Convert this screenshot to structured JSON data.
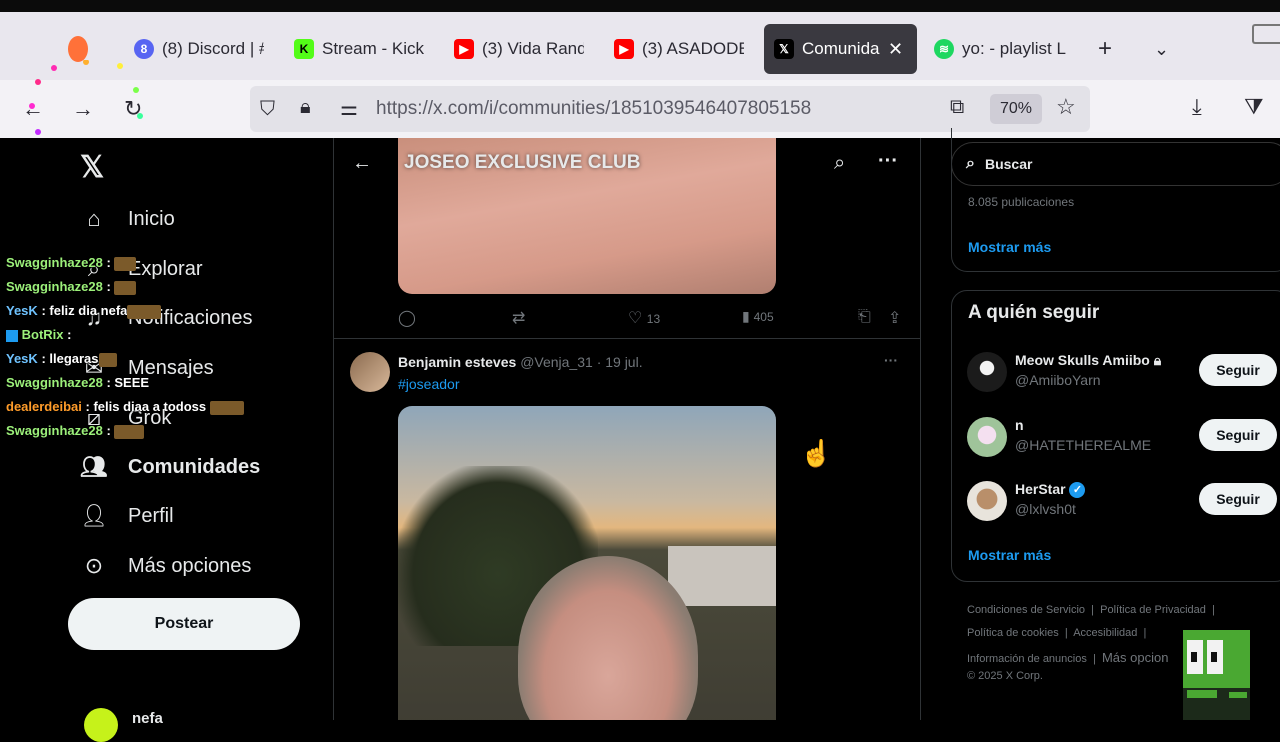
{
  "browser": {
    "tabs": [
      {
        "label": "(8) Discord | #",
        "icon": "discord-icon",
        "color": "#5865f2"
      },
      {
        "label": "Stream - Kick",
        "icon": "kick-icon",
        "color": "#53fc18"
      },
      {
        "label": "(3) Vida Rand",
        "icon": "youtube-icon",
        "color": "#ff0000"
      },
      {
        "label": "(3) ASADODE",
        "icon": "youtube-icon",
        "color": "#ff0000"
      },
      {
        "label": "Comunida",
        "icon": "x-icon",
        "color": "#000000"
      },
      {
        "label": "yo: - playlist L",
        "icon": "spotify-icon",
        "color": "#1ed760"
      }
    ],
    "url": "https://x.com/i/communities/1851039546407805158",
    "zoom": "70%"
  },
  "nav": {
    "items": [
      {
        "label": "Inicio",
        "icon": "home-icon"
      },
      {
        "label": "Explorar",
        "icon": "search-icon"
      },
      {
        "label": "Notificaciones",
        "icon": "bell-icon"
      },
      {
        "label": "Mensajes",
        "icon": "mail-icon"
      },
      {
        "label": "Grok",
        "icon": "grok-icon"
      },
      {
        "label": "Comunidades",
        "icon": "communities-icon"
      },
      {
        "label": "Perfil",
        "icon": "profile-icon"
      },
      {
        "label": "Más opciones",
        "icon": "more-icon"
      }
    ],
    "post_label": "Postear",
    "account_partial": "nefa"
  },
  "chat": [
    {
      "user": "Swagginhaze28",
      "msg": ":"
    },
    {
      "user": "Swagginhaze28",
      "msg": ":"
    },
    {
      "user": "YesK",
      "msg": ": feliz dia nefa"
    },
    {
      "user": "BotRix",
      "msg": ":"
    },
    {
      "user": "YesK",
      "msg": ": llegaras"
    },
    {
      "user": "Swagginhaze28",
      "msg": ": SEEE"
    },
    {
      "user": "dealerdeibai",
      "msg": ": felis diaa a todoss"
    },
    {
      "user": "Swagginhaze28",
      "msg": ":"
    }
  ],
  "community": {
    "title": "JOSEO EXCLUSIVE CLUB",
    "post1": {
      "likes": "13",
      "views": "405"
    },
    "post2": {
      "author": "Benjamin esteves",
      "handle": "@Venja_31",
      "date": "· 19 jul.",
      "hashtag": "#joseador"
    }
  },
  "sidebar": {
    "search_placeholder": "Buscar",
    "posts_count": "8.085 publicaciones",
    "show_more": "Mostrar más",
    "who_to_follow": "A quién seguir",
    "follow_label": "Seguir",
    "accounts": [
      {
        "name": "Meow Skulls Amiibo",
        "handle": "@AmiiboYarn",
        "locked": true,
        "verified": false
      },
      {
        "name": "n",
        "handle": "@HATETHEREALME",
        "locked": false,
        "verified": false
      },
      {
        "name": "HerStar",
        "handle": "@lxlvsh0t",
        "locked": false,
        "verified": true
      }
    ],
    "show_more_2": "Mostrar más",
    "footer": {
      "terms": "Condiciones de Servicio",
      "privacy": "Política de Privacidad",
      "cookies": "Política de cookies",
      "accessibility": "Accesibilidad",
      "ads": "Información de anuncios",
      "more": "Más opcion",
      "corp": "© 2025 X Corp."
    }
  }
}
